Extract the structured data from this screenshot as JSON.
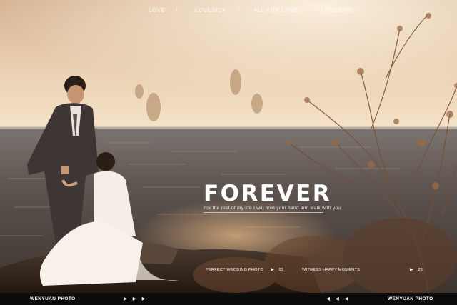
{
  "nav": {
    "items": [
      "LOVE",
      "LOVESICK",
      "ALL FOR LOVE",
      "LOVEBIRD"
    ],
    "separator": "/"
  },
  "hero": {
    "title": "FOREVER",
    "subtitle": "For the rest of my life I will hold your hand and walk with you"
  },
  "captions": {
    "left_label": "PERFECT WEDDING PHOTO",
    "left_number": "23",
    "right_label": "WITNESS HAPPY MOMENTS",
    "right_number": "23",
    "play_glyph": "▶"
  },
  "footer": {
    "brand_left": "WENYUAN PHOTO",
    "brand_right": "WENYUAN PHOTO",
    "next_arrows": "▶ ▶ ▶",
    "prev_arrows": "◀ ◀ ◀"
  },
  "colors": {
    "sky_top": "#d9b896",
    "sky_bottom": "#f2dfc4",
    "sea": "#5c5048",
    "footer_bg": "#0c0c0c"
  }
}
